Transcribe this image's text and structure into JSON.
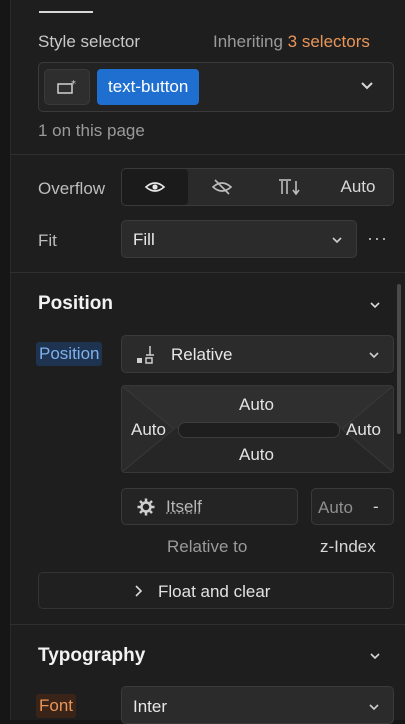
{
  "style_selector": {
    "label": "Style selector",
    "inheriting_prefix": "Inheriting",
    "inheriting_count": "3 selectors",
    "class_chip": "text-button",
    "count_note": "1 on this page"
  },
  "overflow": {
    "label": "Overflow",
    "auto_label": "Auto"
  },
  "fit": {
    "label": "Fit",
    "value": "Fill"
  },
  "position_section": {
    "title": "Position",
    "position_label": "Position",
    "position_value": "Relative",
    "offsets": {
      "top": "Auto",
      "left": "Auto",
      "right": "Auto",
      "bottom": "Auto"
    },
    "relative_to_value": "Itself",
    "z_index_value": "Auto",
    "z_index_suffix": "-",
    "relative_to_label": "Relative to",
    "z_index_label": "z-Index",
    "float_clear": "Float and clear"
  },
  "typography": {
    "title": "Typography",
    "font_label": "Font",
    "font_value": "Inter"
  },
  "colors": {
    "accent_blue": "#1f6fd1",
    "highlight_orange": "#e8955a"
  }
}
